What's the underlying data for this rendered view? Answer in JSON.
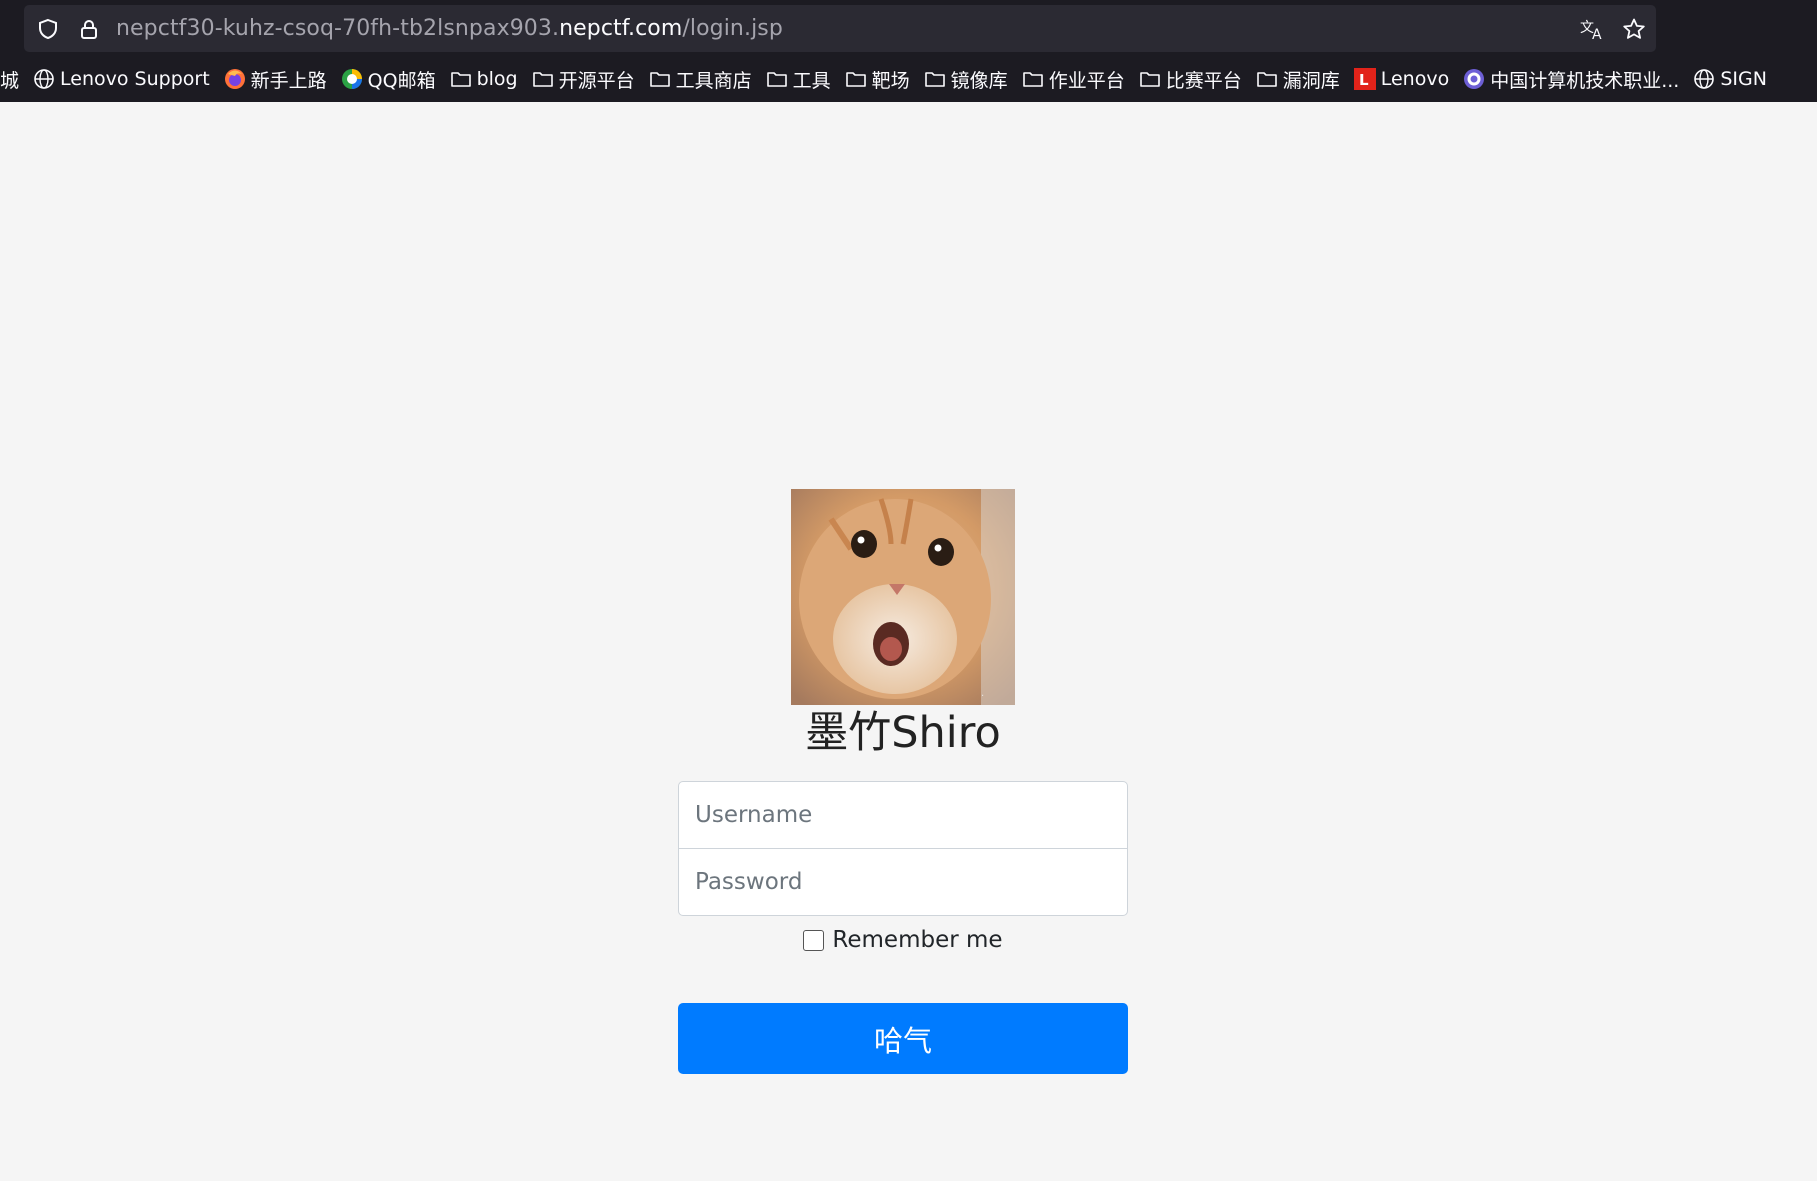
{
  "browser": {
    "url_prefix": "nepctf30-kuhz-csoq-70fh-tb2lsnpax903.",
    "url_domain": "nepctf.com",
    "url_path": "/login.jsp",
    "icons": [
      "shield-icon",
      "lock-icon",
      "translate-icon",
      "star-icon"
    ]
  },
  "bookmarks": [
    {
      "label": "城",
      "icon": "none"
    },
    {
      "label": "Lenovo Support",
      "icon": "globe-icon"
    },
    {
      "label": "新手上路",
      "icon": "firefox-icon"
    },
    {
      "label": "QQ邮箱",
      "icon": "qqmail-icon"
    },
    {
      "label": "blog",
      "icon": "folder-icon"
    },
    {
      "label": "开源平台",
      "icon": "folder-icon"
    },
    {
      "label": "工具商店",
      "icon": "folder-icon"
    },
    {
      "label": "工具",
      "icon": "folder-icon"
    },
    {
      "label": "靶场",
      "icon": "folder-icon"
    },
    {
      "label": "镜像库",
      "icon": "folder-icon"
    },
    {
      "label": "作业平台",
      "icon": "folder-icon"
    },
    {
      "label": "比赛平台",
      "icon": "folder-icon"
    },
    {
      "label": "漏洞库",
      "icon": "folder-icon"
    },
    {
      "label": "Lenovo",
      "icon": "lenovo-icon"
    },
    {
      "label": "中国计算机技术职业...",
      "icon": "ccf-icon"
    },
    {
      "label": "SIGN",
      "icon": "globe-icon"
    }
  ],
  "login": {
    "avatar": "cat-avatar",
    "brand": "墨竹Shiro",
    "username_placeholder": "Username",
    "password_placeholder": "Password",
    "remember_label": "Remember me",
    "submit_label": "哈气"
  },
  "colors": {
    "primary": "#007bff",
    "page_bg": "#f5f5f5",
    "chrome_bg": "#1c1b22"
  }
}
